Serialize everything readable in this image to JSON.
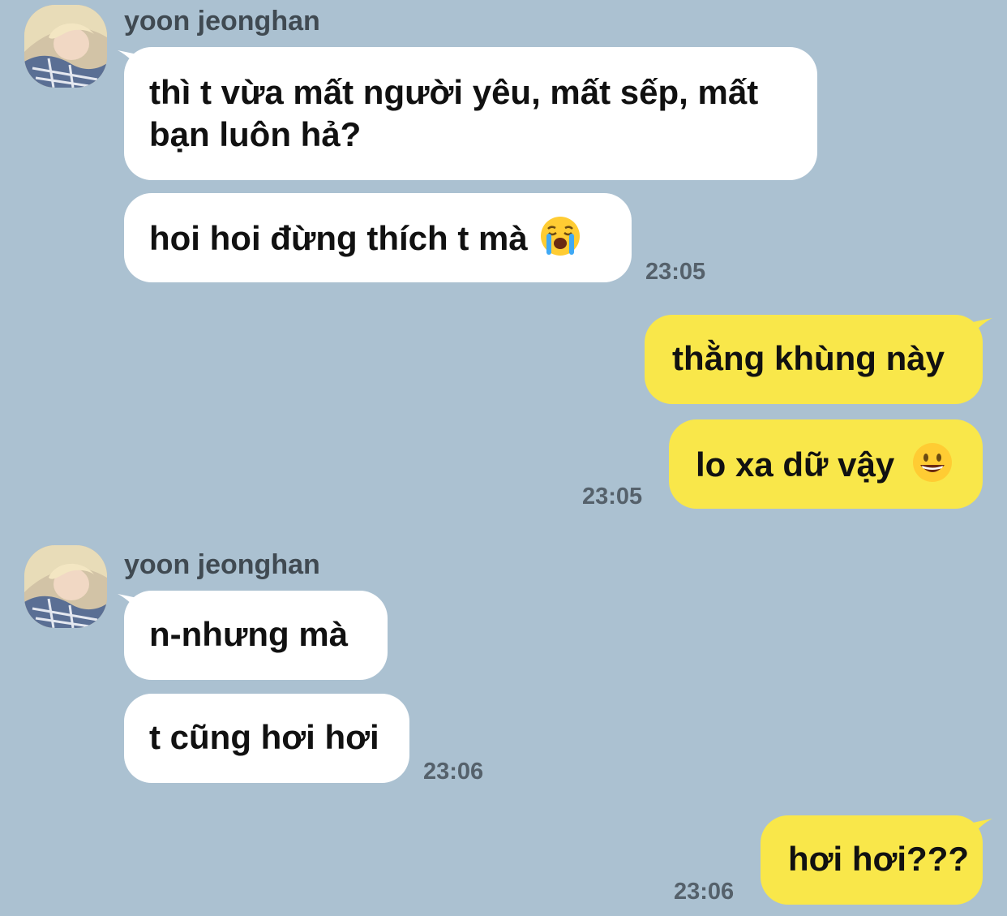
{
  "chat": {
    "groups": [
      {
        "sender": "yoon jeonghan",
        "messages": [
          {
            "line1": "thì t vừa mất người yêu, mất sếp, mất",
            "line2": "bạn luôn hả?"
          },
          {
            "text": "hoi hoi đừng thích t mà"
          }
        ],
        "time": "23:05"
      },
      {
        "messages": [
          {
            "text": "thằng khùng này"
          },
          {
            "text": "lo xa dữ vậy"
          }
        ],
        "time": "23:05"
      },
      {
        "sender": "yoon jeonghan",
        "messages": [
          {
            "text": "n-nhưng mà"
          },
          {
            "text": "t cũng hơi hơi"
          }
        ],
        "time": "23:06"
      },
      {
        "messages": [
          {
            "text": "hơi hơi???"
          }
        ],
        "time": "23:06"
      }
    ]
  },
  "icons": {
    "crying": "loudly-crying-face-emoji",
    "grinning": "grinning-face-emoji"
  },
  "colors": {
    "background": "#abc1d1",
    "incoming_bubble": "#ffffff",
    "outgoing_bubble": "#f9e74a"
  }
}
